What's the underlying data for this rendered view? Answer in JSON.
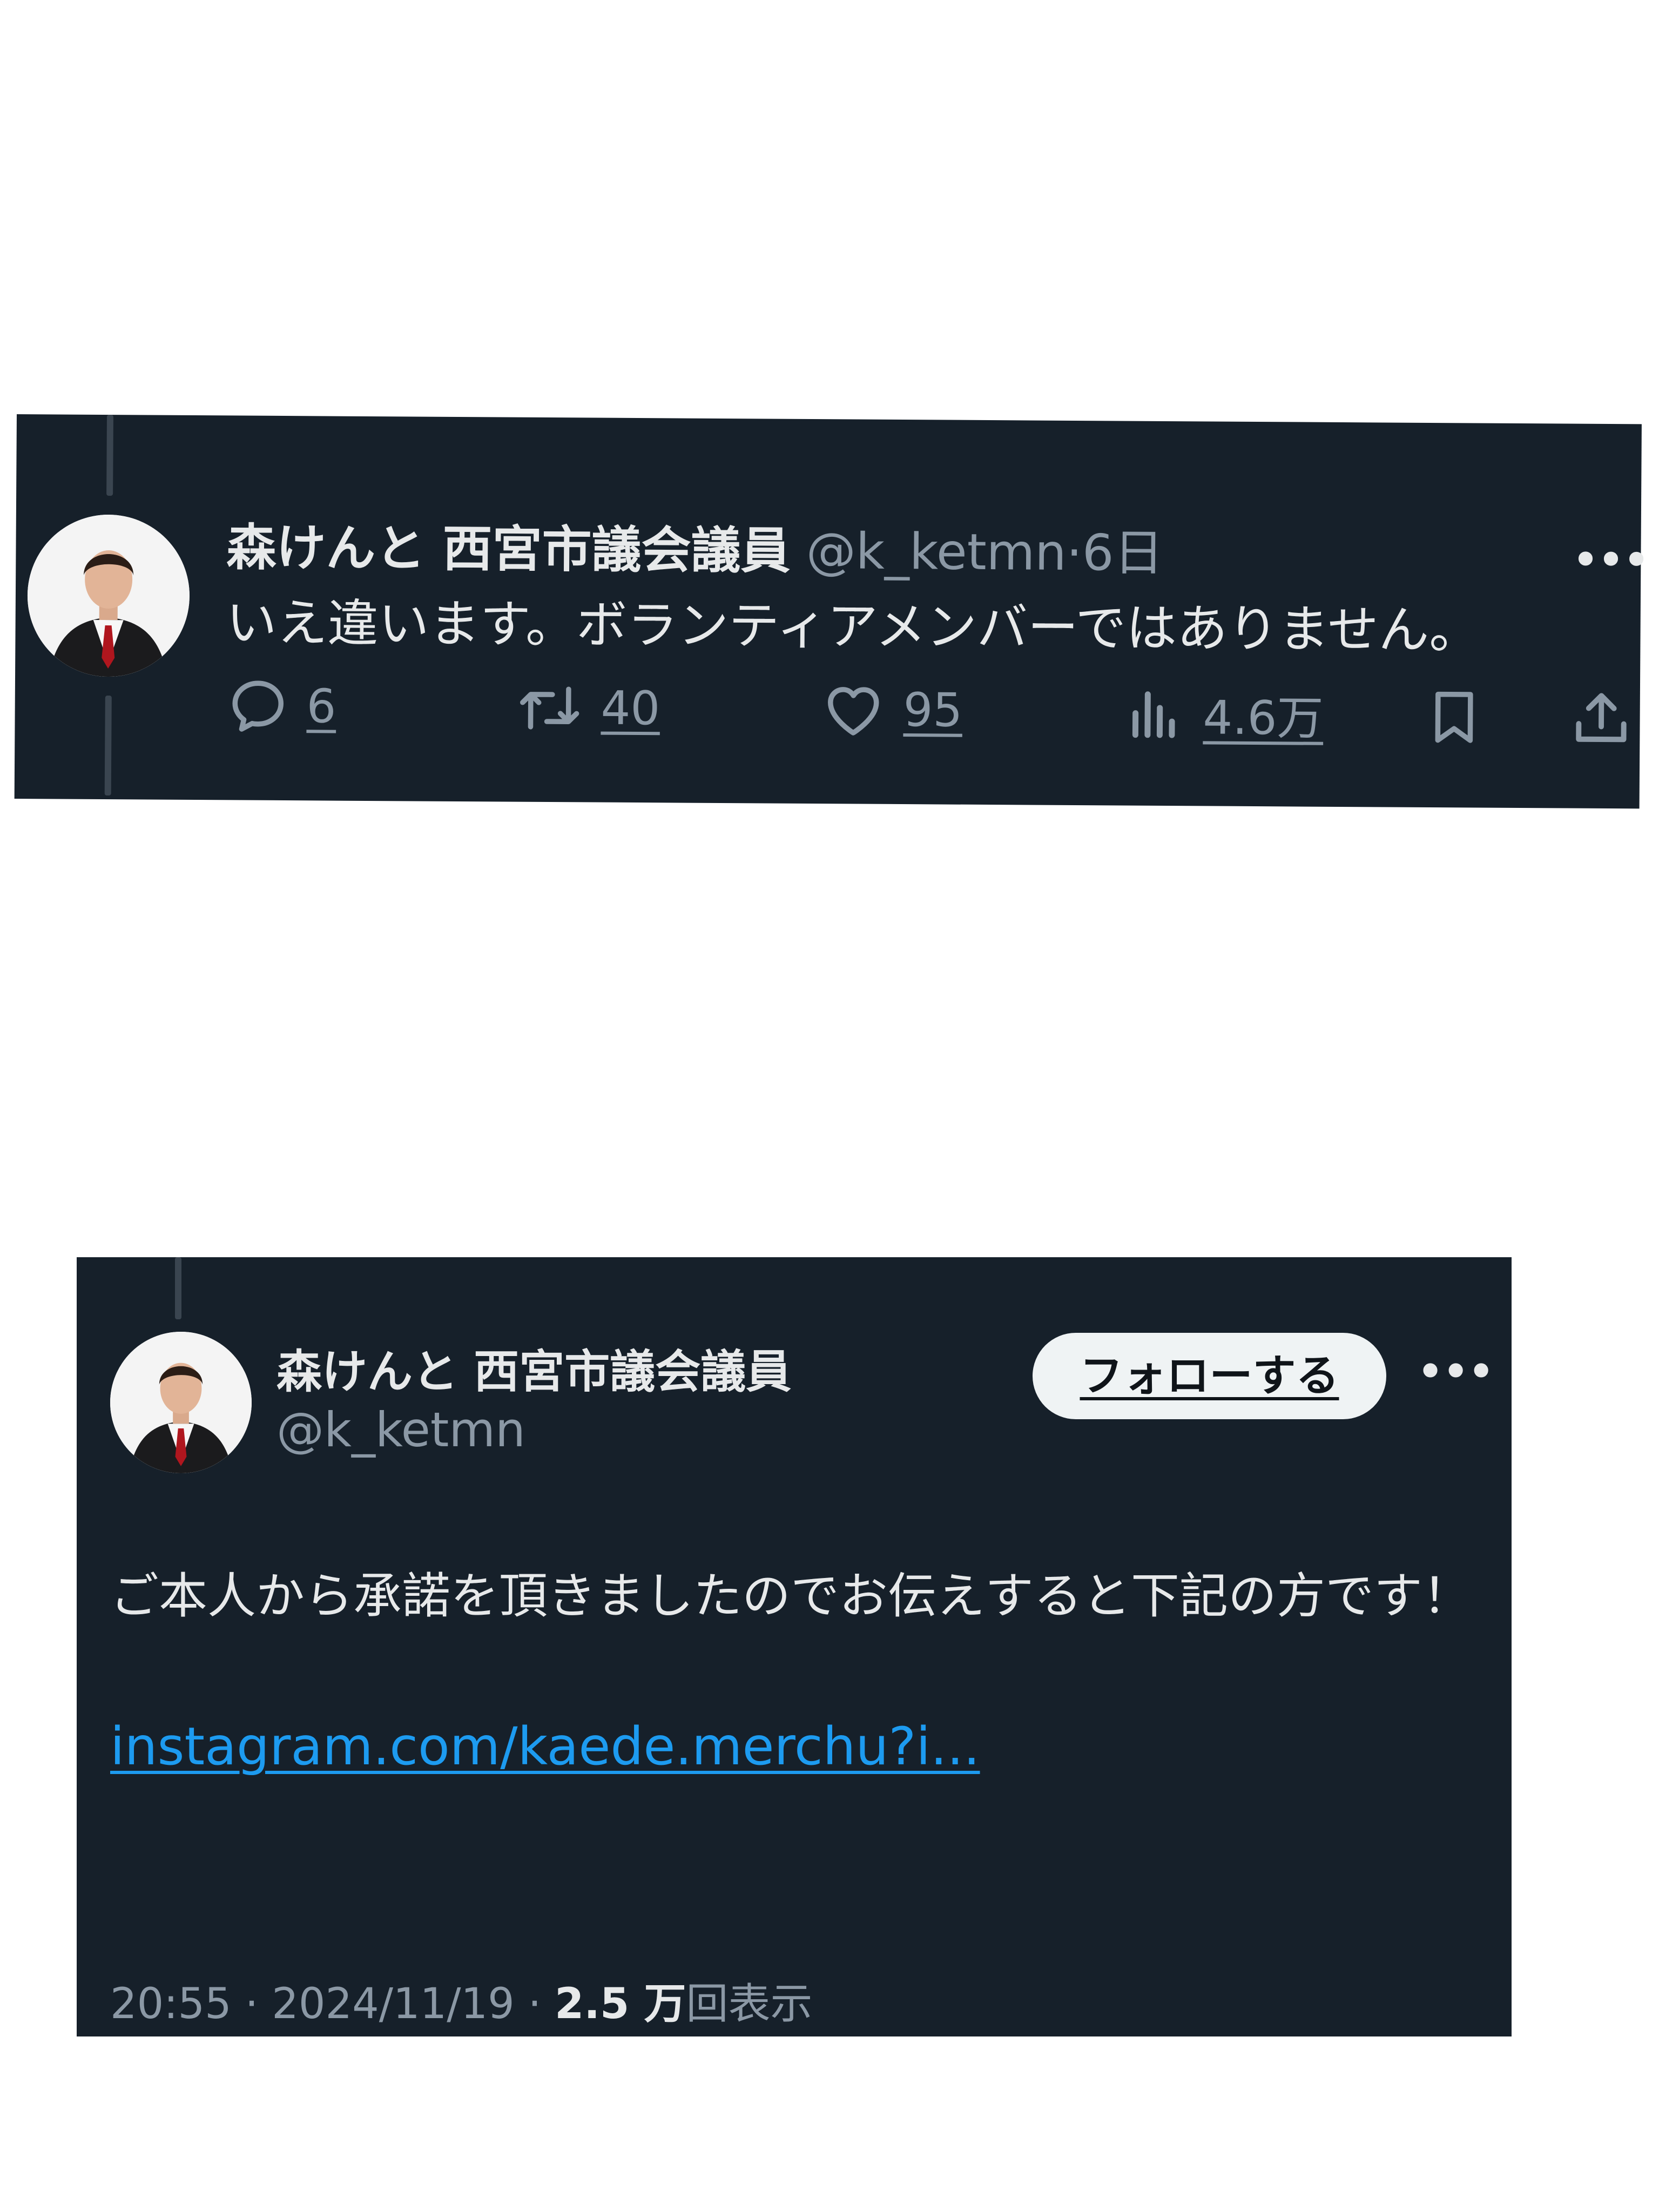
{
  "tweet1": {
    "display_name": "森けんと 西宮市議会議員",
    "handle": "@k_ketmn",
    "separator": "·",
    "time": "6日",
    "more": "•••",
    "text": "いえ違います。ボランティアメンバーではありません。",
    "replies": "6",
    "retweets": "40",
    "likes": "95",
    "views": "4.6万",
    "icons": [
      "reply-icon",
      "retweet-icon",
      "like-icon",
      "views-icon",
      "bookmark-icon",
      "share-icon"
    ]
  },
  "tweet2": {
    "display_name": "森けんと 西宮市議会議員",
    "handle": "@k_ketmn",
    "follow_label": "フォローする",
    "more": "•••",
    "text": "ご本人から承諾を頂きましたのでお伝えすると下記の方です！",
    "link": "instagram.com/kaede.merchu?i...",
    "time": "20:55",
    "date": "2024/11/19",
    "separator": "·",
    "views_count": "2.5 万",
    "views_label": "回表示"
  },
  "colors": {
    "panel_bg": "#16202a",
    "text": "#e7e9ea",
    "muted": "#8b98a5",
    "link": "#1d9bf0",
    "follow_bg": "#eff3f4"
  }
}
